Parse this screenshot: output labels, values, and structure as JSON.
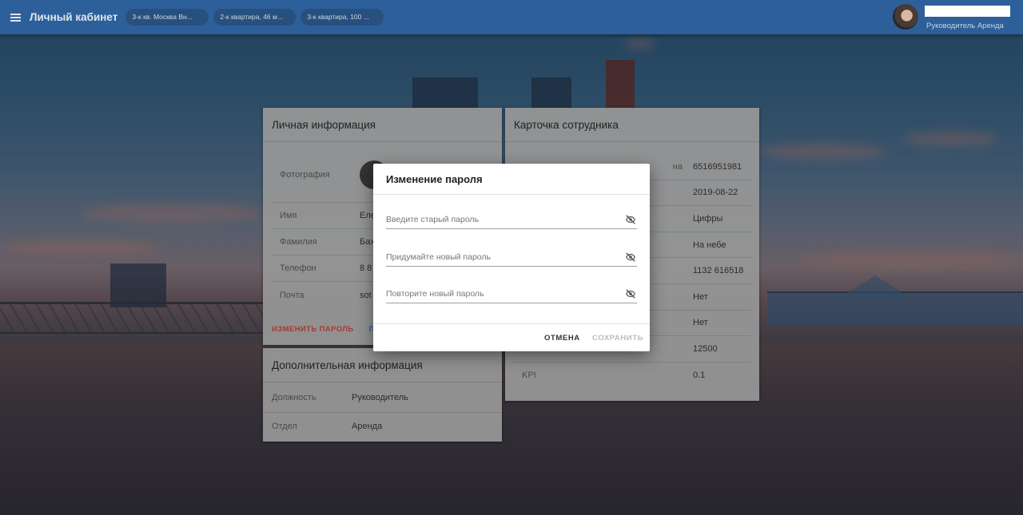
{
  "topbar": {
    "title": "Личный кабинет",
    "chips": [
      "3-к кв. Москва Вн...",
      "2-к квартира, 46 м...",
      "3-к квартира, 100 ..."
    ],
    "user_role": "Руководитель Аренда"
  },
  "personal": {
    "title": "Личная информация",
    "photo_label": "Фотография",
    "rows": [
      {
        "k": "Имя",
        "v": "Еле"
      },
      {
        "k": "Фамилия",
        "v": "Бах"
      },
      {
        "k": "Телефон",
        "v": "8 8"
      },
      {
        "k": "Почта",
        "v": "sot"
      }
    ],
    "action_change_password": "ИЗМЕНИТЬ ПАРОЛЬ",
    "action_other": "П"
  },
  "extra": {
    "title": "Дополнительная информация",
    "rows": [
      {
        "k": "Должность",
        "v": "Руководитель"
      },
      {
        "k": "Отдел",
        "v": "Аренда"
      }
    ]
  },
  "employee": {
    "title": "Карточка сотрудника",
    "rows": [
      {
        "k": "на",
        "v": "6516951981"
      },
      {
        "k": "",
        "v": "2019-08-22"
      },
      {
        "k": "",
        "v": "Цифры"
      },
      {
        "k": "",
        "v": "На небе"
      },
      {
        "k": "",
        "v": "1132 616518"
      },
      {
        "k": "",
        "v": "Нет"
      },
      {
        "k": "",
        "v": "Нет"
      },
      {
        "k": "",
        "v": "12500"
      },
      {
        "k": "KPI",
        "v": "0.1"
      }
    ]
  },
  "dialog": {
    "title": "Изменение пароля",
    "old_placeholder": "Введите старый пароль",
    "new_placeholder": "Придумайте новый пароль",
    "repeat_placeholder": "Повторите новый пароль",
    "cancel": "ОТМЕНА",
    "save": "СОХРАНИТЬ"
  },
  "icons": {
    "menu": "menu-icon",
    "visibility_off": "eye-off-icon"
  }
}
